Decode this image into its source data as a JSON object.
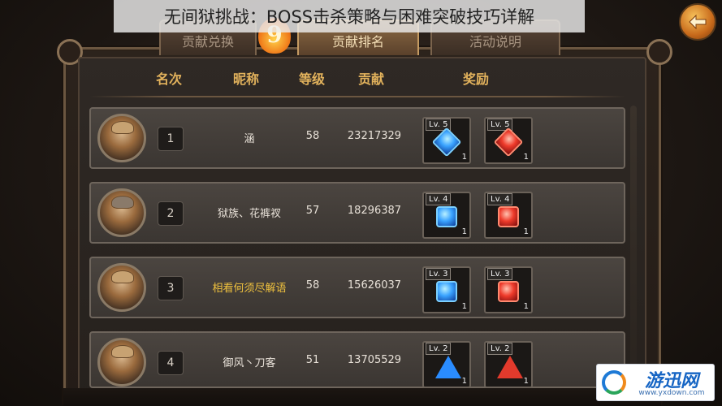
{
  "title_banner": "无间狱挑战：BOSS击杀策略与困难突破技巧详解",
  "tabs": [
    {
      "label": "贡献兑换",
      "active": false
    },
    {
      "label": "贡献排名",
      "active": true
    },
    {
      "label": "活动说明",
      "active": false
    }
  ],
  "tab_badge_number": "9",
  "back_button_icon": "back-arrow-icon",
  "columns": {
    "rank": "名次",
    "nickname": "昵称",
    "level": "等级",
    "contribution": "贡献",
    "reward": "奖励"
  },
  "rows": [
    {
      "rank": "1",
      "name": "涵",
      "name_highlight": false,
      "level": "58",
      "contribution": "23217329",
      "rewards": [
        {
          "lv": "Lv. 5",
          "qty": "1",
          "color": "blue",
          "shape": "diamond"
        },
        {
          "lv": "Lv. 5",
          "qty": "1",
          "color": "red",
          "shape": "diamond"
        }
      ]
    },
    {
      "rank": "2",
      "name": "狱族、花裤衩",
      "name_highlight": false,
      "level": "57",
      "contribution": "18296387",
      "rewards": [
        {
          "lv": "Lv. 4",
          "qty": "1",
          "color": "blue",
          "shape": "square"
        },
        {
          "lv": "Lv. 4",
          "qty": "1",
          "color": "red",
          "shape": "square"
        }
      ]
    },
    {
      "rank": "3",
      "name": "相看何须尽解语",
      "name_highlight": true,
      "level": "58",
      "contribution": "15626037",
      "rewards": [
        {
          "lv": "Lv. 3",
          "qty": "1",
          "color": "blue",
          "shape": "square"
        },
        {
          "lv": "Lv. 3",
          "qty": "1",
          "color": "red",
          "shape": "square"
        }
      ]
    },
    {
      "rank": "4",
      "name": "御风丶刀客",
      "name_highlight": false,
      "level": "51",
      "contribution": "13705529",
      "rewards": [
        {
          "lv": "Lv. 2",
          "qty": "1",
          "color": "blue",
          "shape": "tri"
        },
        {
          "lv": "Lv. 2",
          "qty": "1",
          "color": "red",
          "shape": "tri"
        }
      ]
    }
  ],
  "watermark": {
    "text": "游迅网",
    "url": "www.yxdown.com"
  },
  "colors": {
    "header_gold": "#e2b25c",
    "highlight_name": "#f0c23e",
    "active_tab": "#8c6a45"
  }
}
